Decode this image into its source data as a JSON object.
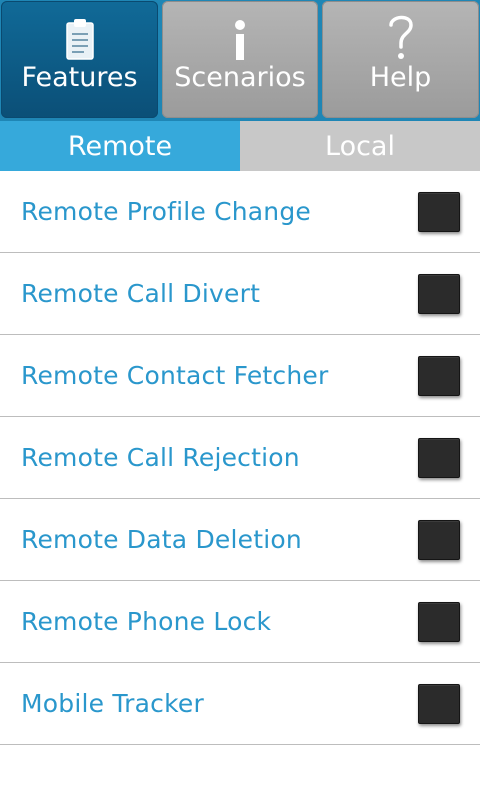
{
  "topnav": {
    "items": [
      {
        "label": "Features",
        "icon": "clipboard-icon",
        "active": true
      },
      {
        "label": "Scenarios",
        "icon": "info-icon",
        "active": false
      },
      {
        "label": "Help",
        "icon": "question-icon",
        "active": false
      }
    ]
  },
  "tabs": [
    {
      "label": "Remote",
      "active": true
    },
    {
      "label": "Local",
      "active": false
    }
  ],
  "features": [
    {
      "label": "Remote Profile Change",
      "checked": false
    },
    {
      "label": "Remote Call Divert",
      "checked": false
    },
    {
      "label": "Remote Contact Fetcher",
      "checked": false
    },
    {
      "label": "Remote Call Rejection",
      "checked": false
    },
    {
      "label": "Remote Data Deletion",
      "checked": false
    },
    {
      "label": "Remote Phone Lock",
      "checked": false
    },
    {
      "label": "Mobile Tracker",
      "checked": false
    }
  ],
  "colors": {
    "accent": "#36a9db",
    "top_bar": "#1f86b5",
    "active_button": "#0b4f77",
    "inactive_button": "#a8a8a8",
    "list_text": "#2a97cc",
    "checkbox": "#2b2b2b"
  }
}
